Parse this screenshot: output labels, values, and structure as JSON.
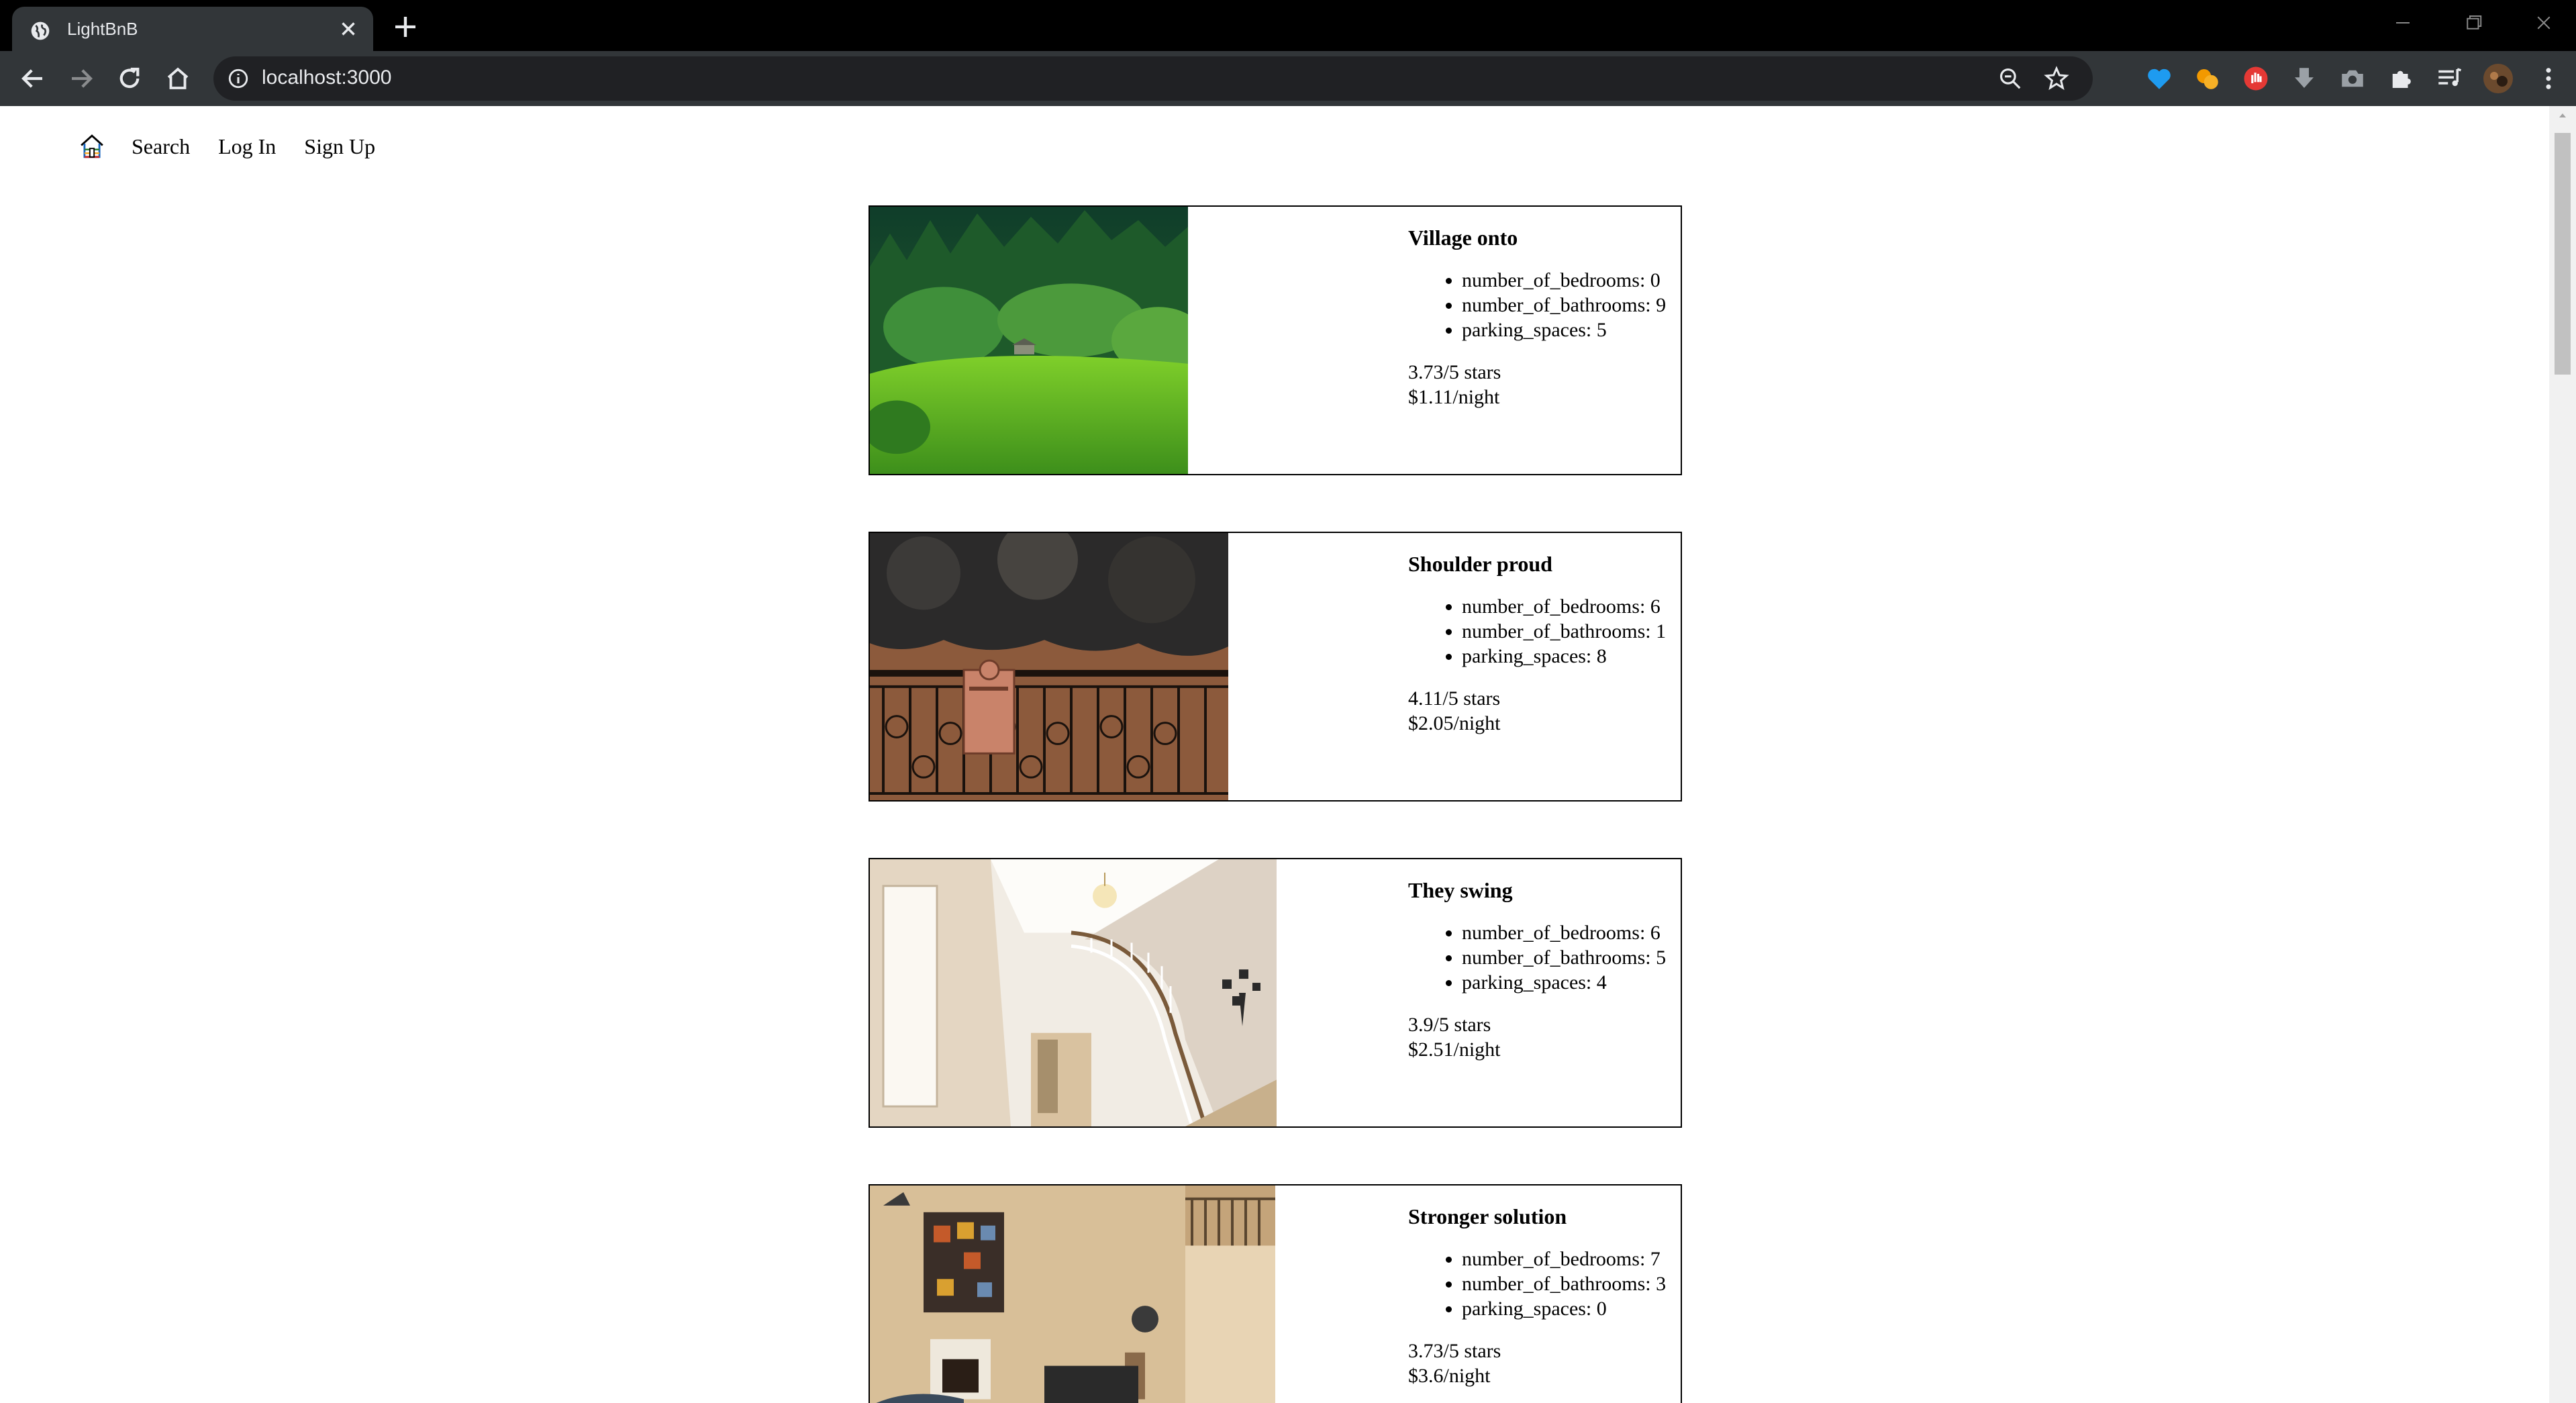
{
  "browser": {
    "tab_title": "LightBnB",
    "url": "localhost:3000"
  },
  "nav": {
    "search": "Search",
    "log_in": "Log In",
    "sign_up": "Sign Up"
  },
  "listings": [
    {
      "title": "Village onto",
      "features": [
        "number_of_bedrooms: 0",
        "number_of_bathrooms: 9",
        "parking_spaces: 5"
      ],
      "rating": "3.73/5 stars",
      "price": "$1.11/night"
    },
    {
      "title": "Shoulder proud",
      "features": [
        "number_of_bedrooms: 6",
        "number_of_bathrooms: 1",
        "parking_spaces: 8"
      ],
      "rating": "4.11/5 stars",
      "price": "$2.05/night"
    },
    {
      "title": "They swing",
      "features": [
        "number_of_bedrooms: 6",
        "number_of_bathrooms: 5",
        "parking_spaces: 4"
      ],
      "rating": "3.9/5 stars",
      "price": "$2.51/night"
    },
    {
      "title": "Stronger solution",
      "features": [
        "number_of_bedrooms: 7",
        "number_of_bathrooms: 3",
        "parking_spaces: 0"
      ],
      "rating": "3.73/5 stars",
      "price": "$3.6/night"
    }
  ]
}
